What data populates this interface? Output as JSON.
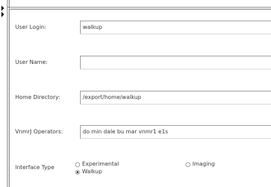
{
  "form": {
    "user_login": {
      "label": "User Login:",
      "value": "walkup"
    },
    "user_name": {
      "label": "User Name:",
      "value": ""
    },
    "home_directory": {
      "label": "Home Directory:",
      "value": "/export/home/walkup"
    },
    "vnmrj_operators": {
      "label": "VnmrJ Operators:",
      "value": "do min  dale bu mar vnmr1  e1s"
    },
    "interface_type": {
      "label": "Interface Type",
      "options": [
        {
          "label": "Experimental",
          "checked": false
        },
        {
          "label": "Walkup",
          "checked": true
        },
        {
          "label": "Imaging",
          "checked": false
        }
      ]
    }
  }
}
